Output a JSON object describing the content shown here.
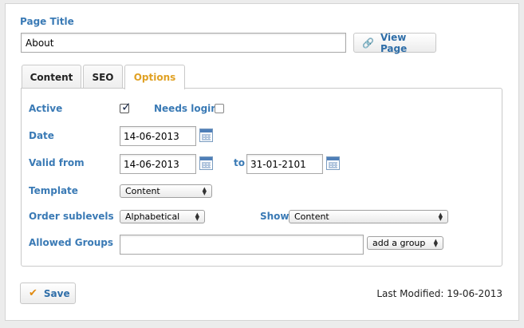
{
  "page_title": {
    "label": "Page Title",
    "value": "About"
  },
  "view_page": {
    "label": "View Page",
    "icon": "link-icon"
  },
  "tabs": [
    {
      "label": "Content",
      "active": false
    },
    {
      "label": "SEO",
      "active": false
    },
    {
      "label": "Options",
      "active": true
    }
  ],
  "options": {
    "active": {
      "label": "Active",
      "checked": true
    },
    "needs_login": {
      "label": "Needs login",
      "checked": false
    },
    "date": {
      "label": "Date",
      "value": "14-06-2013"
    },
    "valid_from": {
      "label": "Valid from",
      "value": "14-06-2013",
      "to_label": "to",
      "to_value": "31-01-2101"
    },
    "template": {
      "label": "Template",
      "selected": "Content"
    },
    "order_sublevels": {
      "label": "Order sublevels",
      "selected": "Alphabetical"
    },
    "show": {
      "label": "Show",
      "selected": "Content"
    },
    "allowed_groups": {
      "label": "Allowed Groups",
      "value": "",
      "add_group_selected": "add a group"
    }
  },
  "footer": {
    "save_label": "Save",
    "last_modified": "Last Modified: 19-06-2013"
  },
  "colors": {
    "label_blue": "#3a7ab5",
    "accent_orange": "#e08a10",
    "active_tab": "#e0a124"
  }
}
